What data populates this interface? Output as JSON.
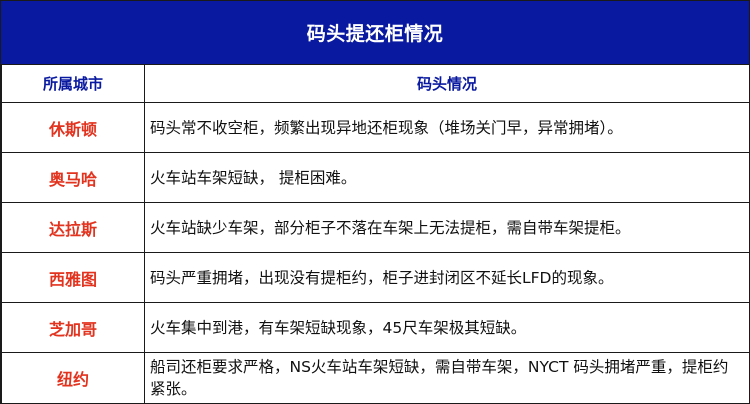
{
  "title": "码头提还柜情况",
  "headers": {
    "city": "所属城市",
    "situation": "码头情况"
  },
  "rows": [
    {
      "city": "休斯顿",
      "situation": "码头常不收空柜，频繁出现异地还柜现象（堆场关门早，异常拥堵）。"
    },
    {
      "city": "奥马哈",
      "situation": "火车站车架短缺， 提柜困难。"
    },
    {
      "city": "达拉斯",
      "situation": "火车站缺少车架，部分柜子不落在车架上无法提柜，需自带车架提柜。"
    },
    {
      "city": "西雅图",
      "situation": "码头严重拥堵，出现没有提柜约，柜子进封闭区不延长LFD的现象。"
    },
    {
      "city": "芝加哥",
      "situation": "火车集中到港，有车架短缺现象，45尺车架极其短缺。"
    },
    {
      "city": "纽约",
      "situation": "船司还柜要求严格，NS火车站车架短缺，需自带车架，NYCT 码头拥堵严重，提柜约紧张。"
    }
  ],
  "colors": {
    "title_bg": "#0a1aa0",
    "header_text": "#0a1aa0",
    "city_text": "#e2331f"
  }
}
